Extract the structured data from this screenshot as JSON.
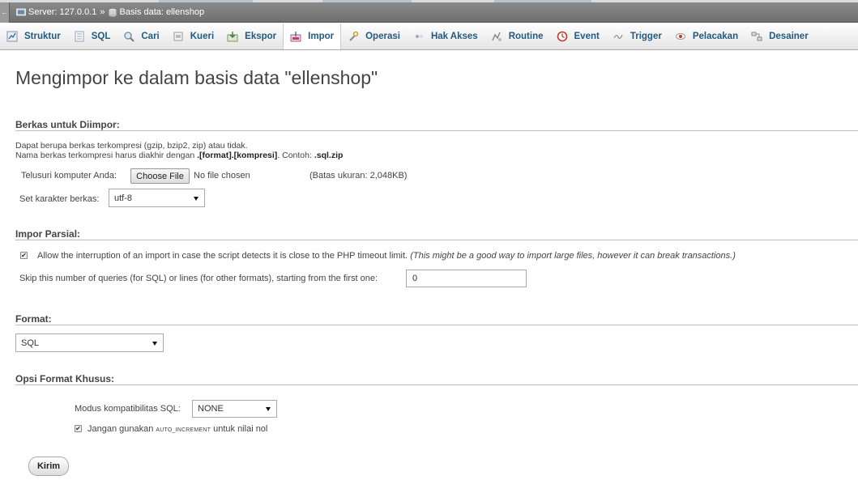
{
  "breadcrumb": {
    "server": "Server: 127.0.0.1",
    "sep": "»",
    "database": "Basis data: ellenshop"
  },
  "tabs": [
    {
      "label": "Struktur",
      "icon": "table-structure-icon"
    },
    {
      "label": "SQL",
      "icon": "sql-icon"
    },
    {
      "label": "Cari",
      "icon": "search-icon"
    },
    {
      "label": "Kueri",
      "icon": "query-icon"
    },
    {
      "label": "Ekspor",
      "icon": "export-icon"
    },
    {
      "label": "Impor",
      "icon": "import-icon"
    },
    {
      "label": "Operasi",
      "icon": "wrench-icon"
    },
    {
      "label": "Hak Akses",
      "icon": "privileges-icon"
    },
    {
      "label": "Routine",
      "icon": "routine-icon"
    },
    {
      "label": "Event",
      "icon": "clock-icon"
    },
    {
      "label": "Trigger",
      "icon": "trigger-icon"
    },
    {
      "label": "Pelacakan",
      "icon": "eye-icon"
    },
    {
      "label": "Desainer",
      "icon": "designer-icon"
    }
  ],
  "page_title": "Mengimpor ke dalam basis data \"ellenshop\"",
  "section_file": {
    "header": "Berkas untuk Diimpor:",
    "line1": "Dapat berupa berkas terkompresi (gzip, bzip2, zip) atau tidak.",
    "line2_prefix": "Nama berkas terkompresi harus diakhir dengan ",
    "line2_bold": ".[format].[kompresi]",
    "line2_mid": ". Contoh: ",
    "line2_example": ".sql.zip",
    "browse_label": "Telusuri komputer Anda:",
    "choose_file": "Choose File",
    "no_file": "No file chosen",
    "size_limit": "(Batas ukuran: 2,048KB)",
    "charset_label": "Set karakter berkas:",
    "charset_value": "utf-8"
  },
  "section_partial": {
    "header": "Impor Parsial:",
    "allow_text": "Allow the interruption of an import in case the script detects it is close to the PHP timeout limit.",
    "allow_italic": "(This might be a good way to import large files, however it can break transactions.)",
    "allow_checked": true,
    "skip_label": "Skip this number of queries (for SQL) or lines (for other formats), starting from the first one:",
    "skip_value": "0"
  },
  "section_format": {
    "header": "Format:",
    "value": "SQL"
  },
  "section_options": {
    "header": "Opsi Format Khusus:",
    "compat_label": "Modus kompatibilitas SQL:",
    "compat_value": "NONE",
    "autoinc_prefix": "Jangan gunakan ",
    "autoinc_code": "AUTO_INCREMENT",
    "autoinc_suffix": " untuk nilai nol",
    "autoinc_checked": true
  },
  "submit_label": "Kirim",
  "colors": {
    "tab_text": "#235a81",
    "crumb_bar": "#7a7a7a"
  }
}
